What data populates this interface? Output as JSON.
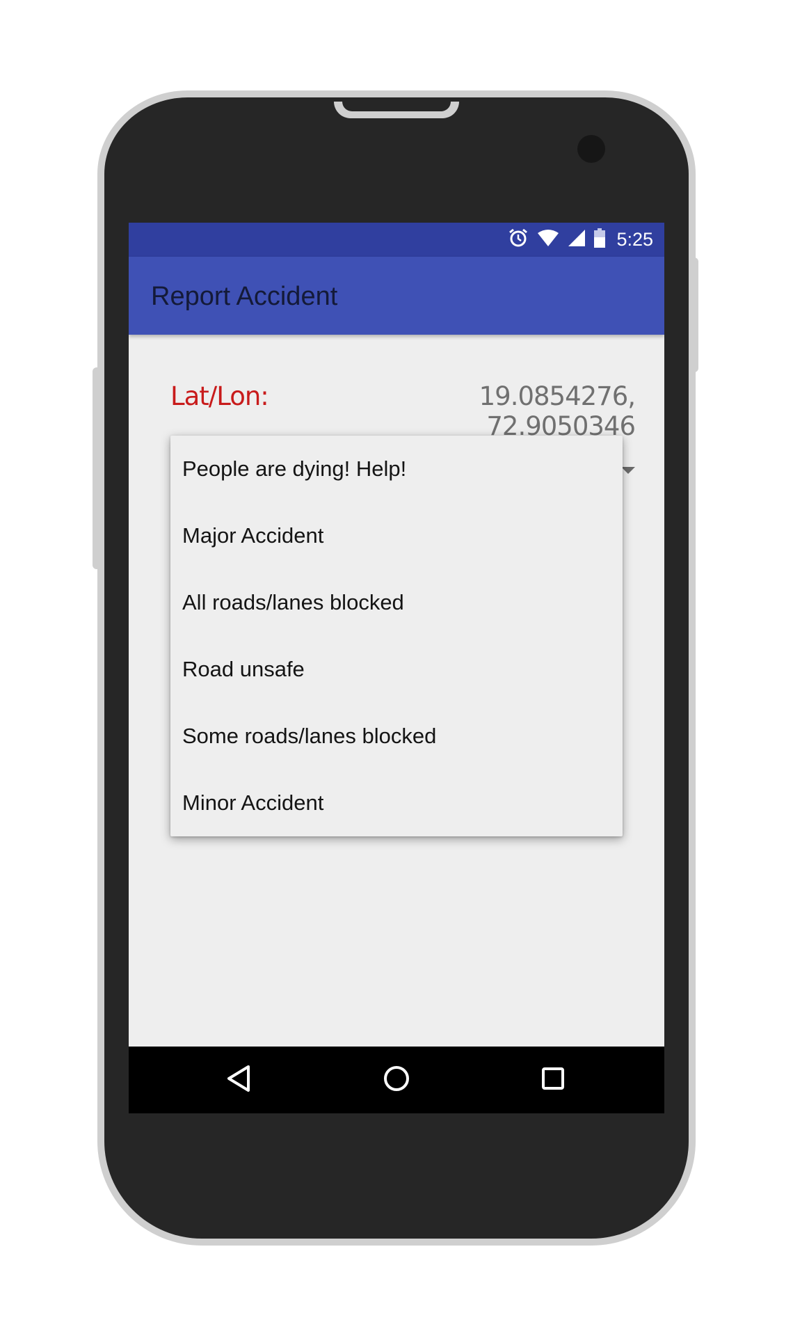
{
  "status_bar": {
    "time": "5:25",
    "icons": [
      "alarm-icon",
      "wifi-icon",
      "signal-icon",
      "battery-icon"
    ]
  },
  "app_bar": {
    "title": "Report Accident"
  },
  "location": {
    "label": "Lat/Lon:",
    "value": "19.0854276, 72.9050346"
  },
  "severity_dropdown": {
    "options": [
      "People are dying! Help!",
      "Major Accident",
      "All roads/lanes blocked",
      "Road unsafe",
      "Some roads/lanes blocked",
      "Minor Accident"
    ]
  },
  "nav_bar": {
    "buttons": [
      "back-icon",
      "home-icon",
      "recents-icon"
    ]
  },
  "colors": {
    "status_bar": "#303f9f",
    "app_bar": "#3f51b5",
    "label_red": "#c81b1b",
    "screen_bg": "#eeeeee"
  }
}
